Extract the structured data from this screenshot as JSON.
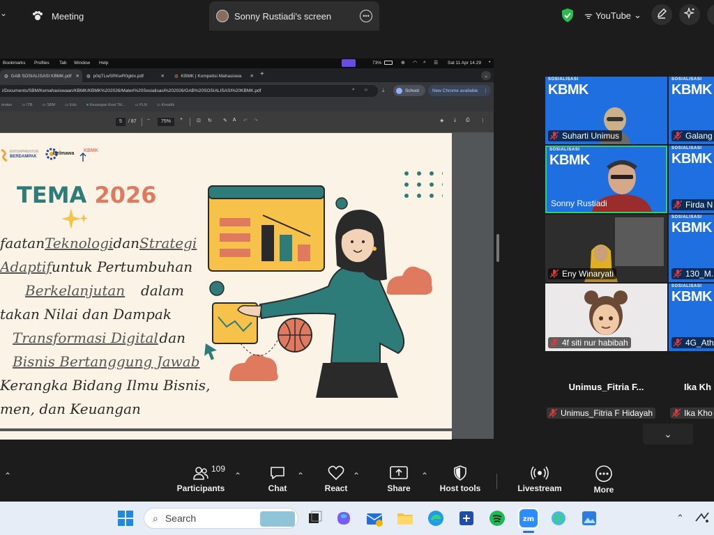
{
  "topbar": {
    "meeting_label": "Meeting",
    "share_label": "Sonny Rustiadi's screen",
    "youtube_label": "YouTube"
  },
  "mac_menu": {
    "items": [
      "Bookmarks",
      "Profiles",
      "Tab",
      "Window",
      "Help"
    ],
    "battery": "73%",
    "clock": "Sat 11 Apr  14.29"
  },
  "chrome": {
    "tabs": [
      "GAB SOSIALISASI KBMK.pdf",
      "p0qTLwSRKwR0gktx.pdf",
      "KBMK | Kompetisi Mahasiswa"
    ],
    "url": "i/Documents/SBM/Kemahasiswaan/KBMK/KBMK%202026/Materi%20Sosialisasi%202026/GAB%20SOSIALISASI%20KBMK.pdf",
    "profile_label": "School",
    "update_label": "New Chrome available",
    "bookmarks": [
      "tentan",
      "ITB",
      "SBM",
      "Edu",
      "Keuangan Kost Titi...",
      "PLN",
      "Kreatifs"
    ],
    "page_current": "5",
    "page_total": "/ 87",
    "zoom": "75%"
  },
  "slide": {
    "logo1_line1": "ENTERPRENTUR",
    "logo1_line2": "BERDAMPAK",
    "logo2": "Belmawa",
    "logo3": "KBMK",
    "title_word": "TEMA",
    "title_year": "2026",
    "lines": [
      {
        "a": "faatan ",
        "u1": "Teknologi",
        "b": " dan ",
        "u2": "Strategi"
      },
      {
        "a": "",
        "u1": "Adaptif",
        "b": " untuk  Pertumbuhan",
        "u2": ""
      },
      {
        "a": "",
        "u1": "Berkelanjutan",
        "b": "          dalam",
        "u2": ""
      },
      {
        "a": "takan  Nilai  dan  Dampak",
        "u1": "",
        "b": "",
        "u2": ""
      },
      {
        "a": "",
        "u1": "Transformasi  Digital",
        "b": "  dan",
        "u2": ""
      },
      {
        "a": "",
        "u1": "Bisnis  Bertanggung  Jawab",
        "b": "",
        "u2": ""
      },
      {
        "a": "Kerangka  Bidang  Ilmu  Bisnis,",
        "u1": "",
        "b": "",
        "u2": ""
      },
      {
        "a": "men, dan Keuangan",
        "u1": "",
        "b": "",
        "u2": ""
      }
    ]
  },
  "gallery": {
    "tiles": [
      {
        "name": "Suharti Unimus",
        "type": "kbmk"
      },
      {
        "name": "Galang",
        "type": "kbmk"
      },
      {
        "name": "Sonny Rustiadi",
        "type": "kbmk"
      },
      {
        "name": "Firda N",
        "type": "kbmk"
      },
      {
        "name": "Eny Winaryati",
        "type": "camera"
      },
      {
        "name": "130_M.",
        "type": "kbmk"
      },
      {
        "name": "4f siti nur habibah",
        "type": "avatar"
      },
      {
        "name": "4G_Ath",
        "type": "kbmk"
      }
    ],
    "kbmk_text": "KBMK",
    "kbmk_small": "SOSIALISASI",
    "big_names": [
      "Unimus_Fitria  F...",
      "Ika Kh"
    ],
    "bottom_names": [
      "Unimus_Fitria F Hidayah",
      "Ika Kho"
    ]
  },
  "controls": {
    "participants_count": "109",
    "participants": "Participants",
    "chat": "Chat",
    "react": "React",
    "share": "Share",
    "host_tools": "Host tools",
    "livestream": "Livestream",
    "more": "More"
  },
  "taskbar": {
    "search_placeholder": "Search"
  },
  "colors": {
    "zoom_bg": "#1c1c1c",
    "kbmk_blue": "#1f6fe0",
    "active_speaker": "#2ed06e",
    "slide_bg": "#fbf3e6",
    "teal": "#2d7c7a",
    "coral": "#e07a5f"
  }
}
